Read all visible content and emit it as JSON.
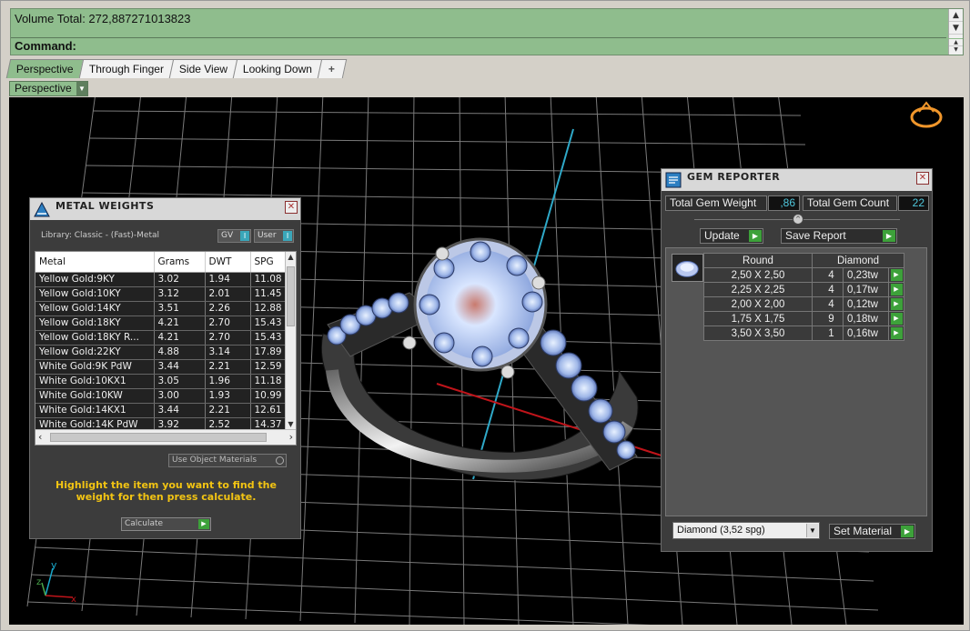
{
  "command": {
    "output_line": "Volume Total: 272,887271013823",
    "prompt_label": "Command:"
  },
  "tabs": [
    {
      "label": "Perspective",
      "active": true
    },
    {
      "label": "Through Finger"
    },
    {
      "label": "Side View"
    },
    {
      "label": "Looking Down"
    }
  ],
  "add_tab": "+",
  "view_select": "Perspective",
  "metal_panel": {
    "title": "METAL WEIGHTS",
    "library": "Library: Classic - (Fast)-Metal",
    "toggle_gv": "GV",
    "toggle_user": "User",
    "headers": [
      "Metal",
      "Grams",
      "DWT",
      "SPG"
    ],
    "rows": [
      [
        "Yellow Gold:9KY",
        "3.02",
        "1.94",
        "11.08"
      ],
      [
        "Yellow Gold:10KY",
        "3.12",
        "2.01",
        "11.45"
      ],
      [
        "Yellow Gold:14KY",
        "3.51",
        "2.26",
        "12.88"
      ],
      [
        "Yellow Gold:18KY",
        "4.21",
        "2.70",
        "15.43"
      ],
      [
        "Yellow Gold:18KY R...",
        "4.21",
        "2.70",
        "15.43"
      ],
      [
        "Yellow Gold:22KY",
        "4.88",
        "3.14",
        "17.89"
      ],
      [
        "White Gold:9K PdW",
        "3.44",
        "2.21",
        "12.59"
      ],
      [
        "White Gold:10KX1",
        "3.05",
        "1.96",
        "11.18"
      ],
      [
        "White Gold:10KW",
        "3.00",
        "1.93",
        "10.99"
      ],
      [
        "White Gold:14KX1",
        "3.44",
        "2.21",
        "12.61"
      ],
      [
        "White Gold:14K PdW",
        "3.92",
        "2.52",
        "14.37"
      ]
    ],
    "use_object_materials": "Use Object Materials",
    "hint": "Highlight the item you want to find the weight for then press calculate.",
    "calculate": "Calculate"
  },
  "gem_panel": {
    "title": "GEM REPORTER",
    "total_weight_label": "Total Gem Weight",
    "total_weight_value": ",86",
    "total_count_label": "Total Gem Count",
    "total_count_value": "22",
    "update": "Update",
    "save_report": "Save Report",
    "col_shape": "Round",
    "col_material": "Diamond",
    "rows": [
      [
        "2,50 X 2,50",
        "4",
        "0,23tw"
      ],
      [
        "2,25 X 2,25",
        "4",
        "0,17tw"
      ],
      [
        "2,00 X 2,00",
        "4",
        "0,12tw"
      ],
      [
        "1,75 X 1,75",
        "9",
        "0,18tw"
      ],
      [
        "3,50 X 3,50",
        "1",
        "0,16tw"
      ]
    ],
    "material_select": "Diamond     (3,52 spg)",
    "set_material": "Set Material"
  },
  "axes": {
    "y": "y",
    "x": "x",
    "z": "z"
  },
  "colors": {
    "accent_green": "#8fbd8d",
    "hint_yellow": "#f2c413",
    "value_cyan": "#4fc7dc",
    "button_green": "#3da13a"
  }
}
